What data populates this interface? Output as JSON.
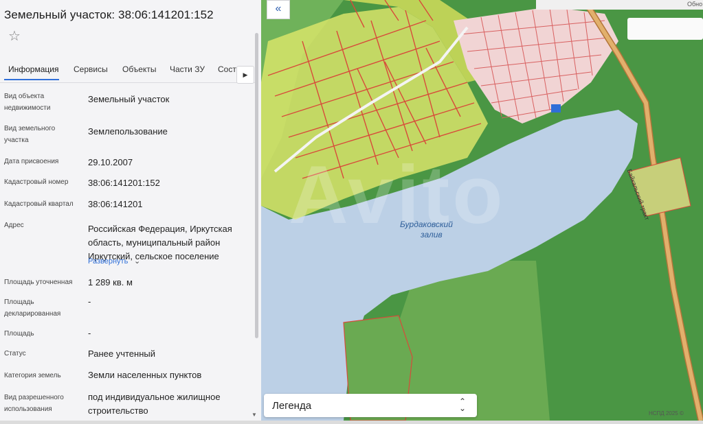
{
  "panel": {
    "title": "Земельный участок: 38:06:141201:152",
    "tabs": [
      "Информация",
      "Сервисы",
      "Объекты",
      "Части ЗУ",
      "Соста"
    ],
    "rows": [
      {
        "label": "Вид объекта недвижимости",
        "value": "Земельный участок"
      },
      {
        "label": "Вид земельного участка",
        "value": "Землепользование"
      },
      {
        "label": "Дата присвоения",
        "value": "29.10.2007"
      },
      {
        "label": "Кадастровый номер",
        "value": "38:06:141201:152"
      },
      {
        "label": "Кадастровый квартал",
        "value": "38:06:141201"
      },
      {
        "label": "Адрес",
        "value": "Российская Федерация, Иркутская область, муниципальный район Иркутский, сельское поселение"
      },
      {
        "label": "Площадь уточненная",
        "value": "1 289 кв. м"
      },
      {
        "label": "Площадь декларированная",
        "value": "-"
      },
      {
        "label": "Площадь",
        "value": "-"
      },
      {
        "label": "Статус",
        "value": "Ранее учтенный"
      },
      {
        "label": "Категория земель",
        "value": "Земли населенных пунктов"
      },
      {
        "label": "Вид разрешенного использования",
        "value": "под индивидуальное жилищное строительство"
      }
    ],
    "expand_label": "Развернуть"
  },
  "map": {
    "bay_label_1": "Бурдаковский",
    "bay_label_2": "залив",
    "road_label": "Байкальский тракт",
    "legend_label": "Легенда",
    "copyright": "НСПД 2025 ©",
    "corner_text": "Обно",
    "watermark": "Avito"
  },
  "icons": {
    "star": "star-icon",
    "collapse": "double-chevron-left-icon",
    "tab_next": "chevron-right-icon",
    "expand": "chevron-down-icon",
    "legend_toggle": "up-down-chevron-icon"
  },
  "colors": {
    "accent": "#2f6fd8",
    "water": "#bcd0e6",
    "forest": "#4f9a45",
    "parcel_yellow": "#d8e46a",
    "parcel_red": "#d84a3a",
    "parcel_pink": "#f1d4d4",
    "road": "#d69b55"
  }
}
